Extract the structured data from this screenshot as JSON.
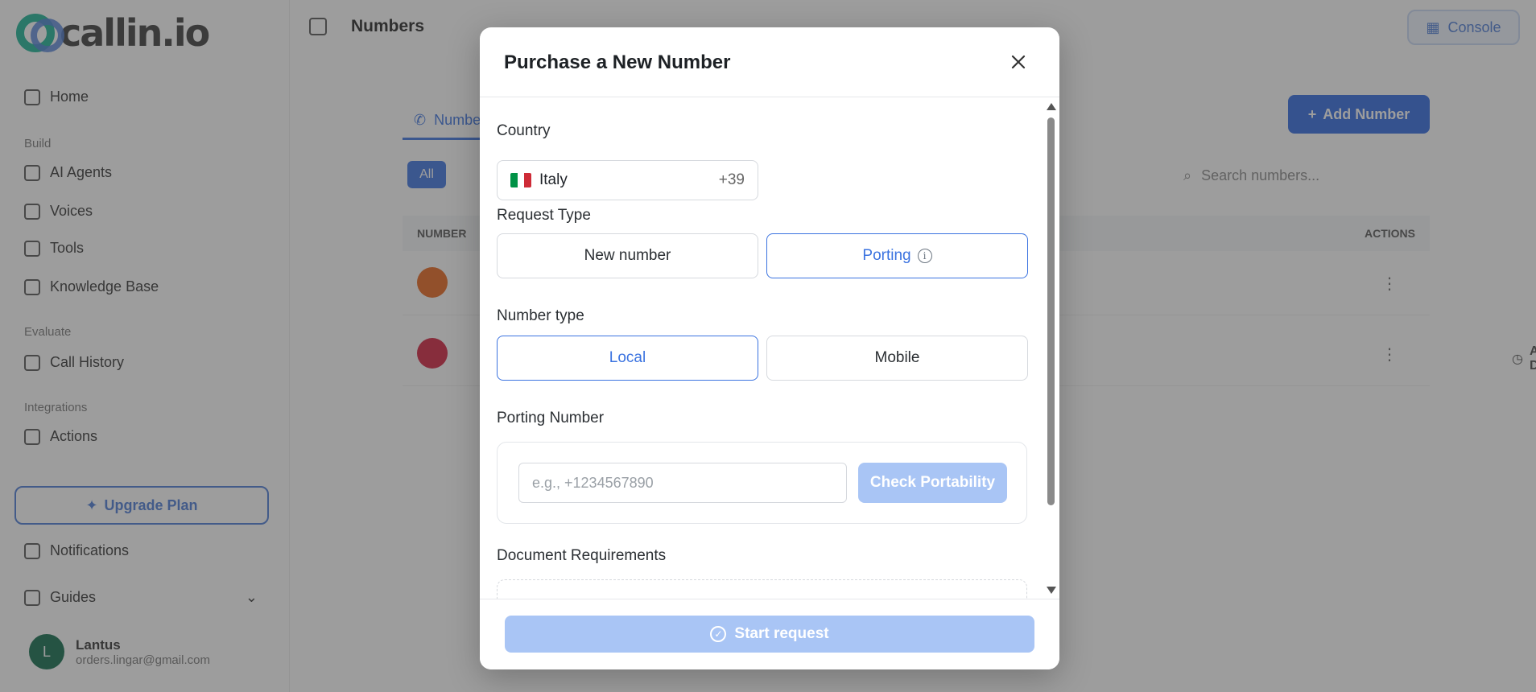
{
  "background": {
    "brand": "callin.io",
    "page_title": "Numbers",
    "console_label": "Console",
    "nav": {
      "home": "Home",
      "section_build": "Build",
      "ai_agents": "AI Agents",
      "voices": "Voices",
      "tools": "Tools",
      "knowledge_base": "Knowledge Base",
      "section_evaluate": "Evaluate",
      "call_history": "Call History",
      "section_integrations": "Integrations",
      "actions": "Actions",
      "upgrade_plan": "Upgrade Plan",
      "notifications": "Notifications",
      "guides": "Guides"
    },
    "user": {
      "initial": "L",
      "name": "Lantus",
      "email": "orders.lingar@gmail.com"
    },
    "tab_label": "Numbers",
    "add_number_label": "Add Number",
    "filter_label": "All",
    "search_placeholder": "Search numbers...",
    "table_headers": {
      "number": "NUMBER",
      "actions": "ACTIONS"
    },
    "row2_status": "AWAITING DOCUMENTS"
  },
  "modal": {
    "title": "Purchase a New Number",
    "country_label": "Country",
    "country": {
      "name": "Italy",
      "dial_code": "+39"
    },
    "request_type_label": "Request Type",
    "request_types": [
      {
        "label": "New number",
        "selected": false
      },
      {
        "label": "Porting",
        "selected": true
      }
    ],
    "number_type_label": "Number type",
    "number_types": [
      {
        "label": "Local",
        "selected": true
      },
      {
        "label": "Mobile",
        "selected": false
      }
    ],
    "porting_number_label": "Porting Number",
    "porting_input": {
      "value": "",
      "placeholder": "e.g., +1234567890"
    },
    "check_portability_label": "Check Portability",
    "document_requirements_label": "Document Requirements",
    "start_request_label": "Start request"
  },
  "colors": {
    "accent": "#3b73e0",
    "disabled_button": "#a9c5f5",
    "overlay": "rgba(60,60,60,0.5)"
  }
}
